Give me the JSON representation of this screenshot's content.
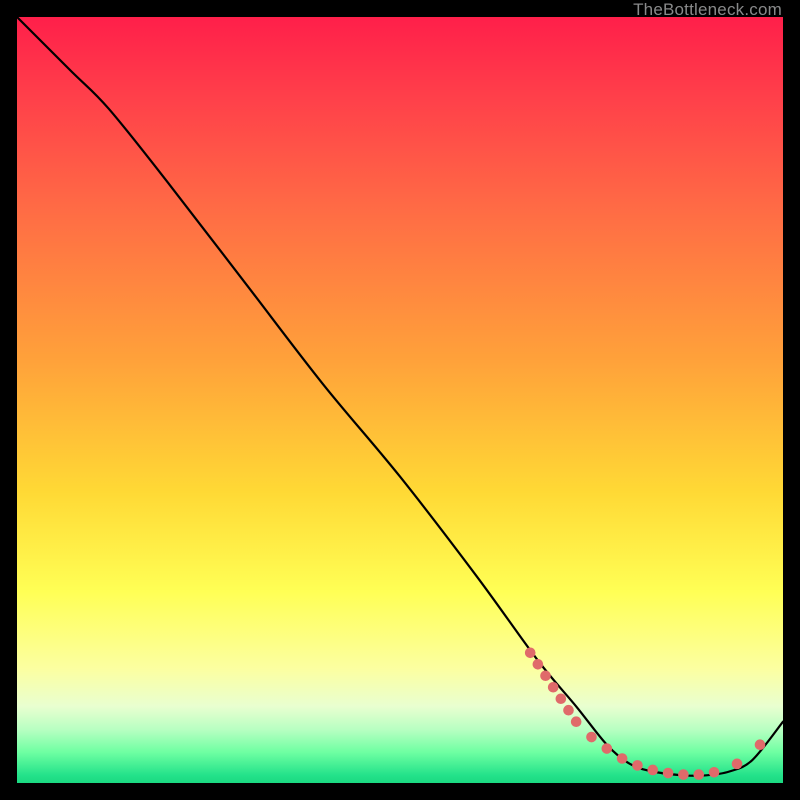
{
  "watermark": {
    "text": "TheBottleneck.com"
  },
  "chart_data": {
    "type": "line",
    "title": "",
    "xlabel": "",
    "ylabel": "",
    "xlim": [
      0,
      100
    ],
    "ylim": [
      0,
      100
    ],
    "series": [
      {
        "name": "bottleneck-curve",
        "x": [
          0,
          7,
          12,
          20,
          30,
          40,
          50,
          60,
          68,
          73,
          77,
          80,
          83,
          87,
          90,
          93,
          96,
          100
        ],
        "values": [
          100,
          93,
          88,
          78,
          65,
          52,
          40,
          27,
          16,
          10,
          5,
          2.5,
          1.5,
          1,
          1,
          1.5,
          3,
          8
        ]
      }
    ],
    "markers": {
      "name": "highlight-dots",
      "color": "#e06a6a",
      "x": [
        67,
        68,
        69,
        70,
        71,
        72,
        73,
        75,
        77,
        79,
        81,
        83,
        85,
        87,
        89,
        91,
        94,
        97
      ],
      "values": [
        17,
        15.5,
        14,
        12.5,
        11,
        9.5,
        8,
        6,
        4.5,
        3.2,
        2.3,
        1.7,
        1.3,
        1.1,
        1.1,
        1.4,
        2.5,
        5
      ]
    }
  }
}
